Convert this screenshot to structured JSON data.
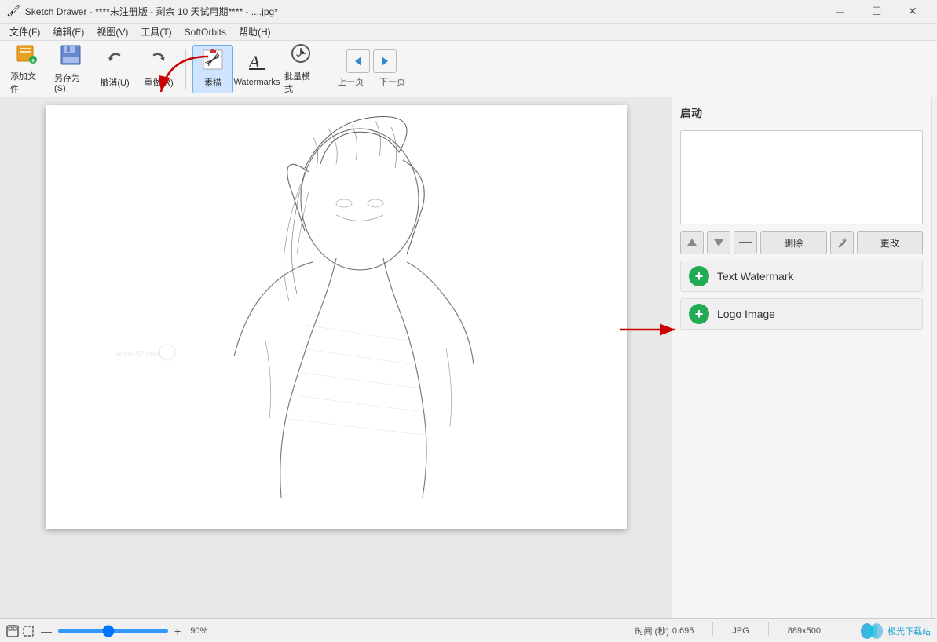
{
  "titleBar": {
    "title": "Sketch Drawer - ****未注册版 - 剩余 10 天试用期**** - ....jpg*",
    "iconSymbol": "🖌",
    "controls": [
      "—",
      "☐",
      "✕"
    ]
  },
  "menuBar": {
    "items": [
      "文件(F)",
      "编辑(E)",
      "视图(V)",
      "工具(T)",
      "SoftOrbits",
      "帮助(H)"
    ]
  },
  "toolbar": {
    "buttons": [
      {
        "label": "添加文件",
        "icon": "📁"
      },
      {
        "label": "另存为(S)",
        "icon": "💾"
      },
      {
        "label": "撤消(U)",
        "icon": "◀"
      },
      {
        "label": "重做(R)",
        "icon": "▶"
      },
      {
        "label": "素描",
        "icon": "🖼",
        "active": true
      },
      {
        "label": "Watermarks",
        "icon": "A"
      },
      {
        "label": "批量模式",
        "icon": "⚙"
      }
    ],
    "navLabels": [
      "上一页",
      "下一页"
    ]
  },
  "canvas": {
    "imageInfo": "sketch of a girl"
  },
  "rightPanel": {
    "title": "启动",
    "previewBox": "",
    "controls": {
      "upArrow": "▲",
      "downArrow": "▼",
      "minus": "—",
      "deleteLabel": "删除",
      "wrench": "🔧",
      "changeLabel": "更改"
    },
    "watermarkButtons": [
      {
        "label": "Text Watermark",
        "icon": "+"
      },
      {
        "label": "Logo Image",
        "icon": "+"
      }
    ]
  },
  "statusBar": {
    "zoomMin": "—",
    "zoomMax": "+",
    "zoomValue": "90%",
    "sliderValue": 90,
    "timeLabel": "时间 (秒)",
    "timeValue": "0.695",
    "format": "JPG",
    "dimensions": "889x500",
    "brand": "极光下载站",
    "brandUrl": "www.52.com"
  },
  "annotations": {
    "arrow1": "points to 素描 button",
    "arrow2": "points to Text Watermark button"
  }
}
